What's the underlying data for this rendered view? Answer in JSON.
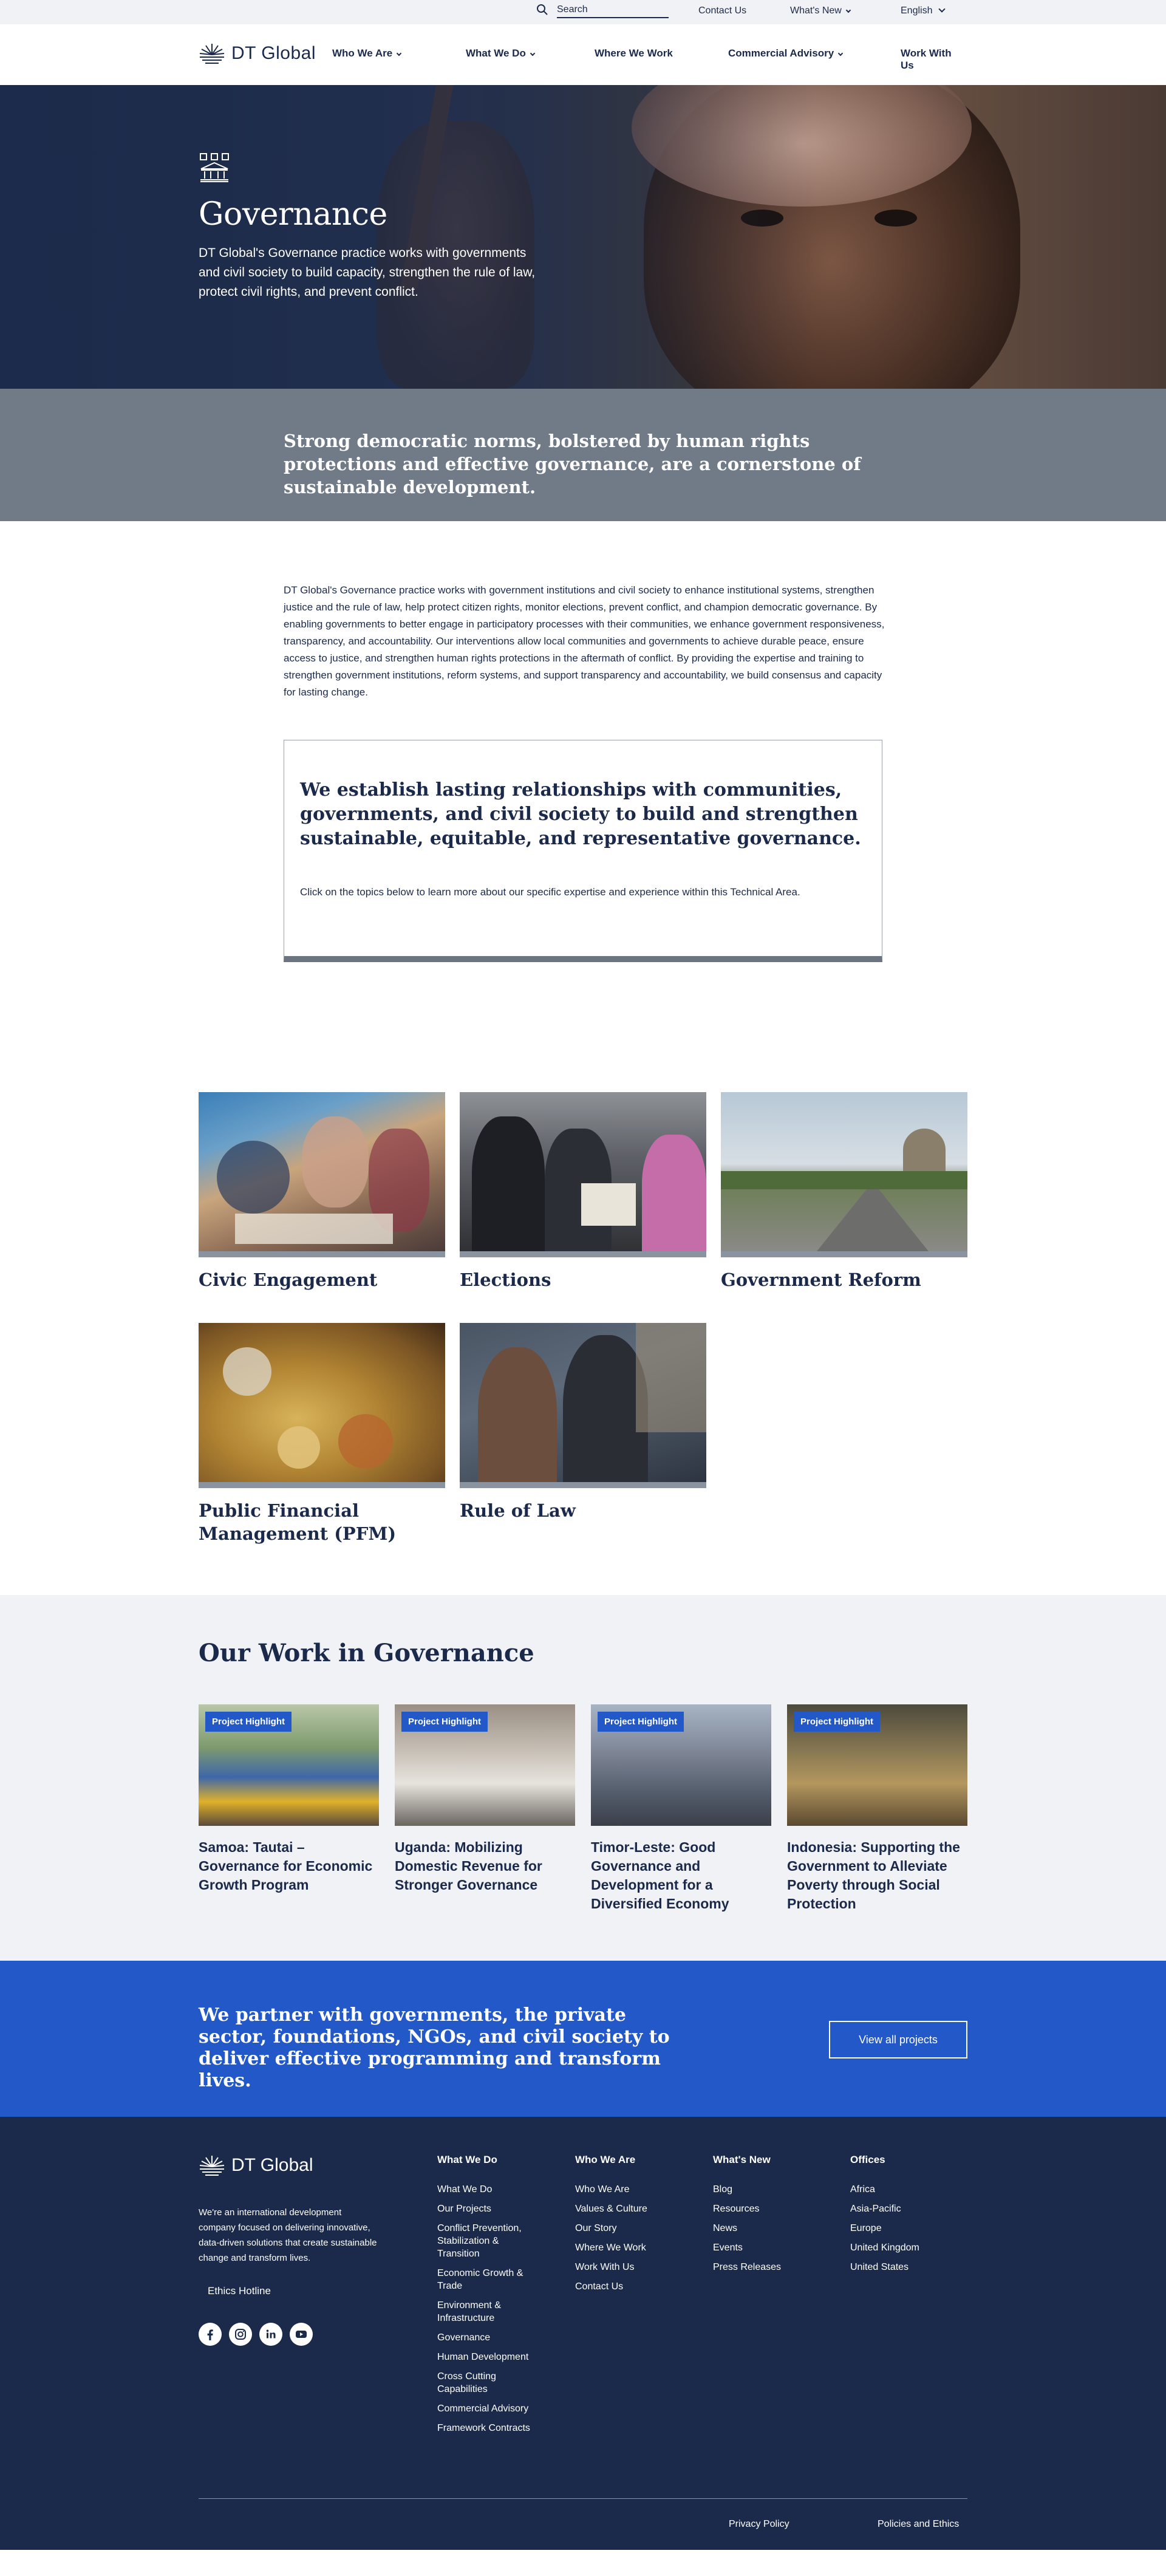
{
  "utility": {
    "search_placeholder": "Search",
    "contact": "Contact Us",
    "whats_new": "What's New",
    "language": "English"
  },
  "nav": {
    "logo": "DT Global",
    "items": [
      "Who We Are",
      "What We Do",
      "Where We Work",
      "Commercial Advisory",
      "Work With Us"
    ]
  },
  "hero": {
    "title": "Governance",
    "description": "DT Global's Governance practice works with governments and civil society to build capacity, strengthen the rule of law, protect civil rights, and prevent conflict."
  },
  "band": {
    "quote": "Strong democratic norms, bolstered by human rights protections and effective governance, are a cornerstone of sustainable development."
  },
  "intro": {
    "text": "DT Global's Governance practice works with government institutions and civil society to enhance institutional systems, strengthen justice and the rule of law, help protect citizen rights, monitor elections, prevent conflict, and champion democratic governance. By enabling governments to better engage in participatory processes with their communities, we enhance government responsiveness, transparency, and accountability. Our interventions allow local communities and governments to achieve durable peace, ensure access to justice, and strengthen human rights protections in the aftermath of conflict. By providing the expertise and training to strengthen government institutions, reform systems, and support transparency and accountability, we build consensus and capacity for lasting change."
  },
  "callout": {
    "heading": "We establish lasting relationships with communities, governments, and civil society to build and strengthen sustainable, equitable, and representative governance.",
    "text": "Click on the topics below to learn more about our specific expertise and experience within this Technical Area."
  },
  "topics": [
    {
      "title": "Civic Engagement"
    },
    {
      "title": "Elections"
    },
    {
      "title": "Government Reform"
    },
    {
      "title": "Public Financial Management (PFM)"
    },
    {
      "title": "Rule of Law"
    }
  ],
  "work": {
    "heading": "Our Work in Governance",
    "badge": "Project Highlight",
    "projects": [
      {
        "title": "Samoa: Tautai – Governance for Economic Growth Program"
      },
      {
        "title": "Uganda: Mobilizing Domestic Revenue for Stronger Governance"
      },
      {
        "title": "Timor-Leste: Good Governance and Development for a Diversified Economy"
      },
      {
        "title": "Indonesia: Supporting the Government to Alleviate Poverty through Social Protection"
      }
    ]
  },
  "cta": {
    "text": "We partner with governments, the private sector, foundations, NGOs, and civil society to deliver effective programming and transform lives.",
    "button": "View all projects"
  },
  "footer": {
    "logo": "DT Global",
    "description": "We're an international development company focused on delivering innovative, data-driven solutions that create sustainable change and transform lives.",
    "hotline": "Ethics Hotline",
    "columns": [
      {
        "heading": "What We Do",
        "items": [
          "What We Do",
          "Our Projects",
          "Conflict Prevention, Stabilization & Transition",
          "Economic Growth & Trade",
          "Environment & Infrastructure",
          "Governance",
          "Human Development",
          "Cross Cutting Capabilities",
          "Commercial Advisory",
          "Framework Contracts"
        ]
      },
      {
        "heading": "Who We Are",
        "items": [
          "Who We Are",
          "Values & Culture",
          "Our Story",
          "Where We Work",
          "Work With Us",
          "Contact Us"
        ]
      },
      {
        "heading": "What's New",
        "items": [
          "Blog",
          "Resources",
          "News",
          "Events",
          "Press Releases"
        ]
      },
      {
        "heading": "Offices",
        "items": [
          "Africa",
          "Asia-Pacific",
          "Europe",
          "United Kingdom",
          "United States"
        ]
      }
    ],
    "privacy": "Privacy Policy",
    "policies": "Policies and Ethics"
  }
}
